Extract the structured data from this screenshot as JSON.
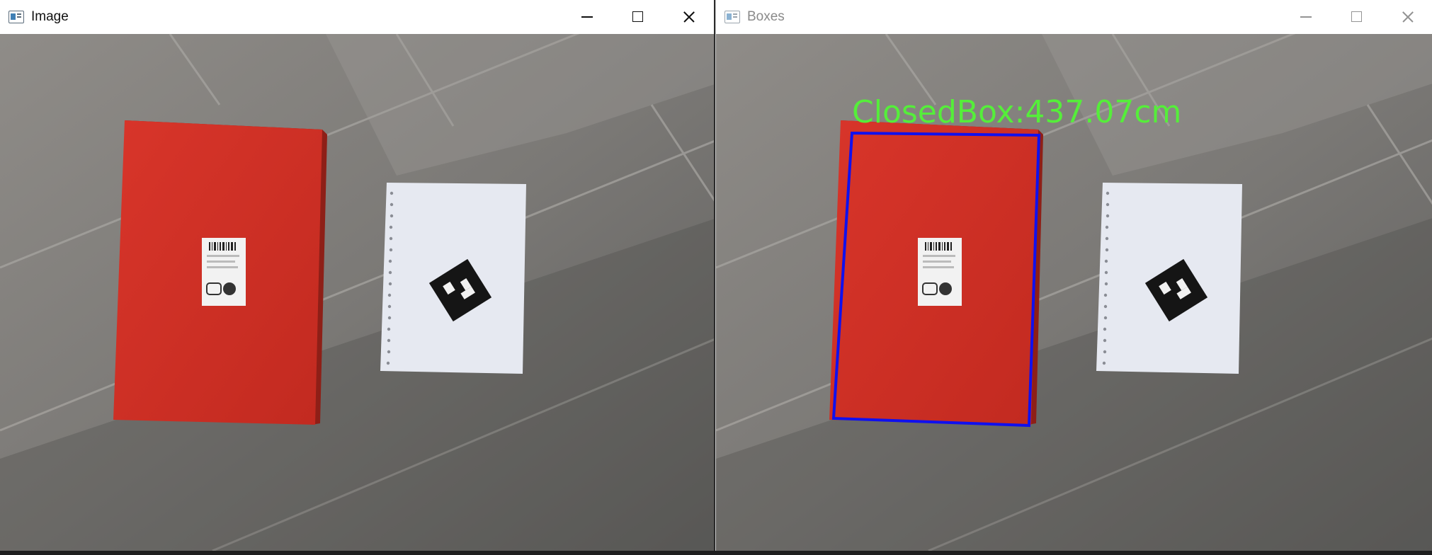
{
  "windows": [
    {
      "title": "Image"
    },
    {
      "title": "Boxes"
    }
  ],
  "overlay": {
    "label": "ClosedBox:437.07cm",
    "label_color": "#55ee3a",
    "box_color": "#1010ee"
  },
  "icons": {
    "minimize": "minimize-icon",
    "maximize": "maximize-icon",
    "close": "close-icon"
  }
}
